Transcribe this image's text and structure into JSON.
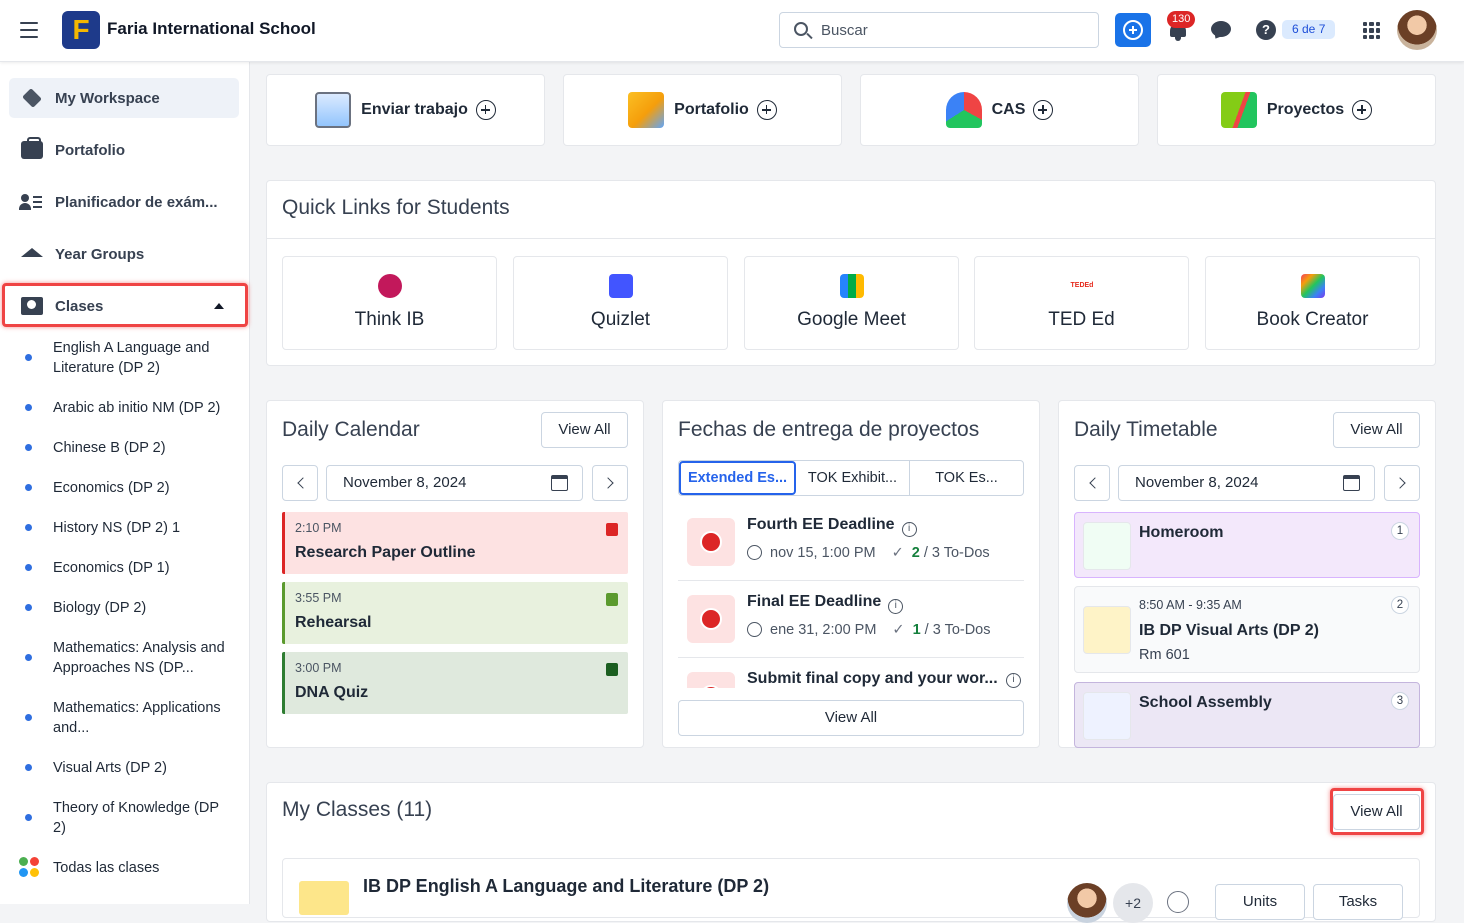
{
  "header": {
    "school_name": "Faria International School",
    "logo_letter": "F",
    "search_placeholder": "Buscar",
    "notifications_count": "130",
    "help_icon": "?",
    "pager": "6 de 7"
  },
  "sidebar": {
    "items": [
      {
        "label": "My Workspace",
        "icon": "workspace-icon"
      },
      {
        "label": "Portafolio",
        "icon": "briefcase-icon"
      },
      {
        "label": "Planificador de exám...",
        "icon": "exam-planner-icon"
      },
      {
        "label": "Year Groups",
        "icon": "graduation-cap-icon"
      },
      {
        "label": "Clases",
        "icon": "classes-icon"
      }
    ],
    "classes": [
      "English A Language and Literature (DP 2)",
      "Arabic ab initio NM (DP 2)",
      "Chinese B (DP 2)",
      "Economics (DP 2)",
      "History NS (DP 2) 1",
      "Economics (DP 1)",
      "Biology (DP 2)",
      "Mathematics: Analysis and Approaches NS (DP...",
      "Mathematics: Applications and...",
      "Visual Arts (DP 2)",
      "Theory of Knowledge (DP 2)"
    ],
    "all_classes": "Todas las clases"
  },
  "actions": [
    {
      "label": "Enviar trabajo",
      "icon": "submit-work-icon"
    },
    {
      "label": "Portafolio",
      "icon": "portfolio-icon"
    },
    {
      "label": "CAS",
      "icon": "cas-icon"
    },
    {
      "label": "Proyectos",
      "icon": "projects-icon"
    }
  ],
  "quick_links": {
    "title": "Quick Links for Students",
    "items": [
      {
        "label": "Think IB",
        "color": "#c2185b"
      },
      {
        "label": "Quizlet",
        "color": "#4255ff"
      },
      {
        "label": "Google Meet",
        "color": "#00832d"
      },
      {
        "label": "TED Ed",
        "color": "#e62b1e",
        "mark": "TEDEd"
      },
      {
        "label": "Book Creator",
        "color": "#7c3aed"
      }
    ]
  },
  "daily_calendar": {
    "title": "Daily Calendar",
    "view_all": "View All",
    "date": "November 8, 2024",
    "events": [
      {
        "time": "2:10 PM",
        "name": "Research Paper Outline",
        "bg": "#fde2e2",
        "accent": "#dc2626"
      },
      {
        "time": "3:55 PM",
        "name": "Rehearsal",
        "bg": "#e8f1de",
        "accent": "#5b9a2e"
      },
      {
        "time": "3:00 PM",
        "name": "DNA Quiz",
        "bg": "#dfe9dd",
        "accent": "#2e7d32"
      }
    ]
  },
  "deadlines": {
    "title": "Fechas de entrega de proyectos",
    "tabs": [
      "Extended Es...",
      "TOK Exhibit...",
      "TOK Es..."
    ],
    "items": [
      {
        "name": "Fourth EE Deadline",
        "date": "nov 15, 1:00 PM",
        "done": "2",
        "total": " / 3 To-Dos"
      },
      {
        "name": "Final EE Deadline",
        "date": "ene 31, 2:00 PM",
        "done": "1",
        "total": " / 3 To-Dos"
      },
      {
        "name": "Submit final copy and your wor...",
        "date": "",
        "done": "",
        "total": ""
      }
    ],
    "view_all": "View All"
  },
  "timetable": {
    "title": "Daily Timetable",
    "view_all": "View All",
    "date": "November 8, 2024",
    "periods": [
      {
        "num": "1",
        "name": "Homeroom",
        "time": "",
        "room": ""
      },
      {
        "num": "2",
        "name": "IB DP Visual Arts (DP 2)",
        "time": "8:50 AM - 9:35 AM",
        "room": "Rm 601"
      },
      {
        "num": "3",
        "name": "School Assembly",
        "time": "",
        "room": ""
      }
    ]
  },
  "my_classes": {
    "title": "My Classes (11)",
    "view_all": "View All",
    "first_class": "IB DP English A Language and Literature (DP 2)",
    "extra_members": "+2",
    "units": "Units",
    "tasks": "Tasks"
  }
}
